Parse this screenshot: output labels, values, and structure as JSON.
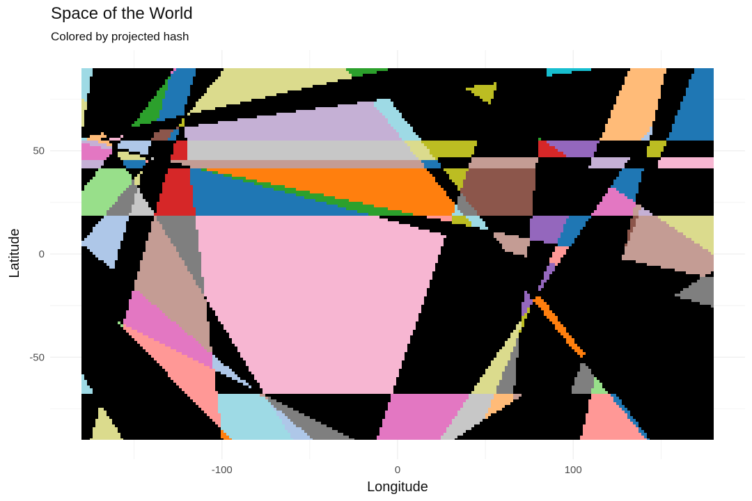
{
  "chart_data": {
    "type": "heatmap",
    "title": "Space of the World",
    "subtitle": "Colored by projected hash",
    "xlabel": "Longitude",
    "ylabel": "Latitude",
    "xlim": [
      -180,
      180
    ],
    "ylim": [
      -90,
      90
    ],
    "x_ticks": [
      -100,
      0,
      100
    ],
    "x_tick_labels": [
      "-100",
      "0",
      "100"
    ],
    "y_ticks": [
      50,
      0,
      -50
    ],
    "y_tick_labels": [
      "50",
      "0",
      "-50"
    ],
    "grid": true,
    "legend": "none",
    "palette": [
      "#1f77b4",
      "#ff7f0e",
      "#2ca02c",
      "#d62728",
      "#9467bd",
      "#8c564b",
      "#e377c2",
      "#7f7f7f",
      "#bcbd22",
      "#17becf",
      "#aec7e8",
      "#ffbb78",
      "#98df8a",
      "#ff9896",
      "#c5b0d5",
      "#c49c94",
      "#f7b6d2",
      "#c7c7c7",
      "#dbdb8d",
      "#9edae5"
    ]
  }
}
